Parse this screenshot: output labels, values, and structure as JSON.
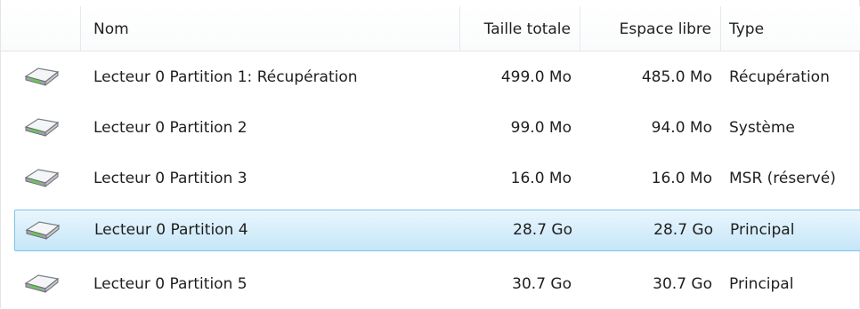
{
  "columns": {
    "name": "Nom",
    "total": "Taille totale",
    "free": "Espace libre",
    "type": "Type"
  },
  "rows": [
    {
      "name": "Lecteur 0 Partition 1: Récupération",
      "total": "499.0 Mo",
      "free": "485.0 Mo",
      "type": "Récupération",
      "icon": "hard-drive-icon"
    },
    {
      "name": "Lecteur 0 Partition 2",
      "total": "99.0 Mo",
      "free": "94.0 Mo",
      "type": "Système",
      "icon": "hard-drive-icon"
    },
    {
      "name": "Lecteur 0 Partition 3",
      "total": "16.0 Mo",
      "free": "16.0 Mo",
      "type": "MSR (réservé)",
      "icon": "hard-drive-icon"
    },
    {
      "name": "Lecteur 0 Partition 4",
      "total": "28.7 Go",
      "free": "28.7 Go",
      "type": "Principal",
      "icon": "hard-drive-icon",
      "selected": true
    },
    {
      "name": "Lecteur 0 Partition 5",
      "total": "30.7 Go",
      "free": "30.7 Go",
      "type": "Principal",
      "icon": "hard-drive-icon"
    }
  ],
  "colors": {
    "selection_border": "#7dc3ea",
    "selection_fill_top": "#eaf6fd",
    "selection_fill_bottom": "#c5e6f8",
    "header_separator": "#e6e9ed"
  }
}
